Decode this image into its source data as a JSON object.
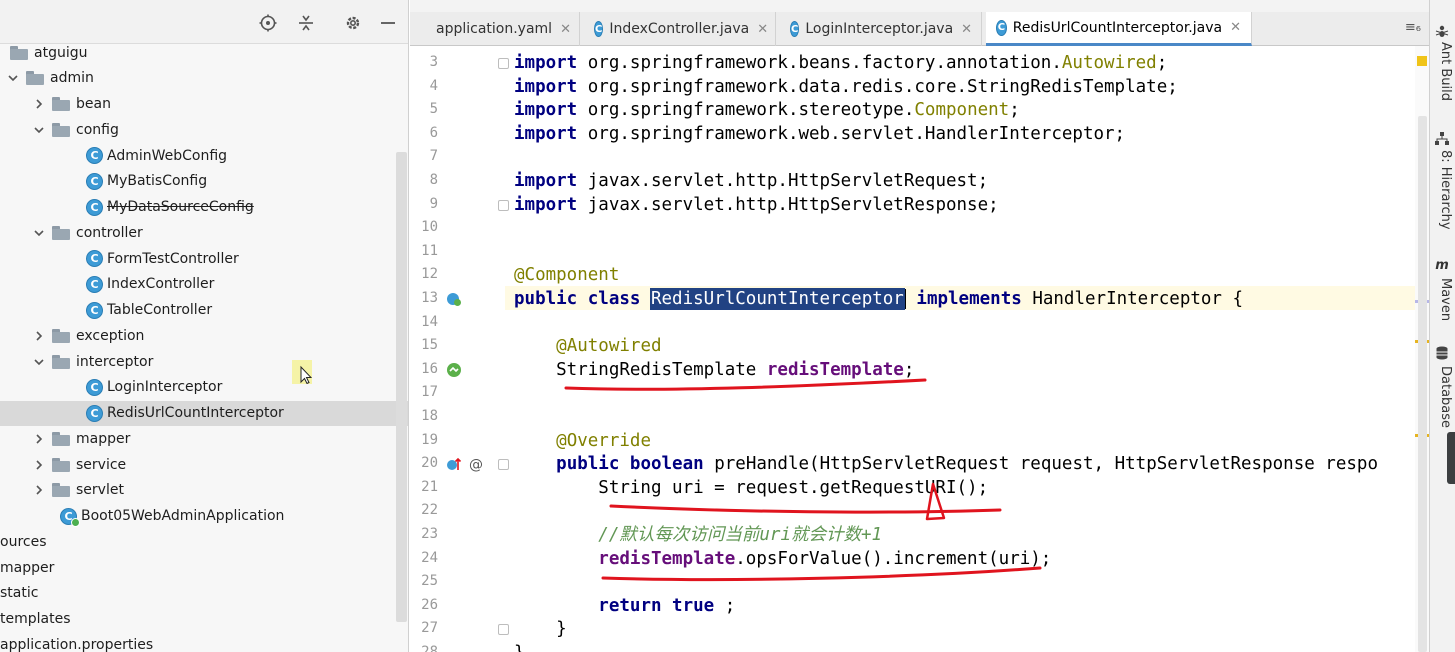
{
  "project": {
    "tools": [
      "locate-icon",
      "collapse-icon",
      "gear-icon",
      "minimize-icon"
    ],
    "tree": [
      {
        "label": "atguigu",
        "level": 0,
        "type": "folder",
        "expanded": null
      },
      {
        "label": "admin",
        "level": 1,
        "type": "folder",
        "expanded": true
      },
      {
        "label": "bean",
        "level": 2,
        "type": "folder",
        "expanded": false
      },
      {
        "label": "config",
        "level": 2,
        "type": "folder",
        "expanded": true
      },
      {
        "label": "AdminWebConfig",
        "level": 3,
        "type": "class"
      },
      {
        "label": "MyBatisConfig",
        "level": 3,
        "type": "class"
      },
      {
        "label": "MyDataSourceConfig",
        "level": 3,
        "type": "class",
        "strike": true
      },
      {
        "label": "controller",
        "level": 2,
        "type": "folder",
        "expanded": true
      },
      {
        "label": "FormTestController",
        "level": 3,
        "type": "class"
      },
      {
        "label": "IndexController",
        "level": 3,
        "type": "class"
      },
      {
        "label": "TableController",
        "level": 3,
        "type": "class"
      },
      {
        "label": "exception",
        "level": 2,
        "type": "folder",
        "expanded": false
      },
      {
        "label": "interceptor",
        "level": 2,
        "type": "folder",
        "expanded": true
      },
      {
        "label": "LoginInterceptor",
        "level": 3,
        "type": "class"
      },
      {
        "label": "RedisUrlCountInterceptor",
        "level": 3,
        "type": "class",
        "selected": true
      },
      {
        "label": "mapper",
        "level": 2,
        "type": "folder",
        "expanded": false
      },
      {
        "label": "service",
        "level": 2,
        "type": "folder",
        "expanded": false
      },
      {
        "label": "servlet",
        "level": 2,
        "type": "folder",
        "expanded": false
      },
      {
        "label": "Boot05WebAdminApplication",
        "level": 2,
        "type": "app"
      },
      {
        "label": "ources",
        "level": -1,
        "type": "text"
      },
      {
        "label": "mapper",
        "level": -1,
        "type": "text"
      },
      {
        "label": "static",
        "level": -1,
        "type": "text"
      },
      {
        "label": "templates",
        "level": -1,
        "type": "text"
      },
      {
        "label": "application.properties",
        "level": -1,
        "type": "text"
      }
    ]
  },
  "tabs": [
    {
      "label": "application.yaml",
      "icon": "yaml-icon",
      "active": false
    },
    {
      "label": "IndexController.java",
      "icon": "class-icon",
      "active": false
    },
    {
      "label": "LoginInterceptor.java",
      "icon": "class-icon",
      "active": false
    },
    {
      "label": "RedisUrlCountInterceptor.java",
      "icon": "class-icon",
      "active": true
    }
  ],
  "tab_menu": "≡₆",
  "code": {
    "lines": [
      {
        "n": "3",
        "parts": [
          [
            "kw",
            "import"
          ],
          [
            "",
            "org.springframework.beans.factory.annotation."
          ],
          [
            "ann",
            "Autowired"
          ],
          [
            "",
            ";"
          ]
        ]
      },
      {
        "n": "4",
        "parts": [
          [
            "kw",
            "import"
          ],
          [
            "",
            "org.springframework.data.redis.core.StringRedisTemplate;"
          ]
        ]
      },
      {
        "n": "5",
        "parts": [
          [
            "kw",
            "import"
          ],
          [
            "",
            "org.springframework.stereotype."
          ],
          [
            "ann",
            "Component"
          ],
          [
            "",
            ";"
          ]
        ]
      },
      {
        "n": "6",
        "parts": [
          [
            "kw",
            "import"
          ],
          [
            "",
            "org.springframework.web.servlet.HandlerInterceptor;"
          ]
        ]
      },
      {
        "n": "7",
        "parts": []
      },
      {
        "n": "8",
        "parts": [
          [
            "kw",
            "import"
          ],
          [
            "",
            "javax.servlet.http.HttpServletRequest;"
          ]
        ]
      },
      {
        "n": "9",
        "parts": [
          [
            "kw",
            "import"
          ],
          [
            "",
            "javax.servlet.http.HttpServletResponse;"
          ]
        ]
      },
      {
        "n": "10",
        "parts": []
      },
      {
        "n": "11",
        "parts": []
      },
      {
        "n": "12",
        "parts": [
          [
            "ann",
            "@Component"
          ]
        ]
      },
      {
        "n": "13",
        "parts": [
          [
            "kw",
            "public class"
          ],
          [
            "",
            ""
          ],
          [
            "sel",
            "RedisUrlCountInterceptor"
          ],
          [
            "",
            ""
          ],
          [
            "kw",
            "implements"
          ],
          [
            "",
            "HandlerInterceptor {"
          ]
        ]
      },
      {
        "n": "14",
        "parts": []
      },
      {
        "n": "15",
        "parts": [
          [
            "",
            "    "
          ],
          [
            "ann",
            "@Autowired"
          ]
        ]
      },
      {
        "n": "16",
        "parts": [
          [
            "",
            "    StringRedisTemplate "
          ],
          [
            "fld",
            "redisTemplate"
          ],
          [
            "",
            ";"
          ]
        ]
      },
      {
        "n": "17",
        "parts": []
      },
      {
        "n": "18",
        "parts": []
      },
      {
        "n": "19",
        "parts": [
          [
            "",
            "    "
          ],
          [
            "ann",
            "@Override"
          ]
        ]
      },
      {
        "n": "20",
        "parts": [
          [
            "",
            "    "
          ],
          [
            "kw",
            "public boolean"
          ],
          [
            "",
            "preHandle(HttpServletRequest request, HttpServletResponse respo"
          ]
        ]
      },
      {
        "n": "21",
        "parts": [
          [
            "",
            "        String uri = request.getRequestURI();"
          ]
        ]
      },
      {
        "n": "22",
        "parts": []
      },
      {
        "n": "23",
        "parts": [
          [
            "",
            "        "
          ],
          [
            "cmt",
            "//默认每次访问当前uri就会计数+1"
          ]
        ]
      },
      {
        "n": "24",
        "parts": [
          [
            "",
            "        "
          ],
          [
            "fld",
            "redisTemplate"
          ],
          [
            "",
            ".opsForValue().increment(uri);"
          ]
        ]
      },
      {
        "n": "25",
        "parts": []
      },
      {
        "n": "26",
        "parts": [
          [
            "",
            "        "
          ],
          [
            "kw",
            "return true"
          ],
          [
            "",
            ";"
          ]
        ]
      },
      {
        "n": "27",
        "parts": [
          [
            "",
            "    }"
          ]
        ]
      },
      {
        "n": "28",
        "parts": [
          [
            "",
            "}"
          ]
        ]
      }
    ]
  },
  "right_tools": [
    "Ant Build",
    "8: Hierarchy",
    "Maven",
    "Database"
  ],
  "colors": {
    "keyword": "#000080",
    "annotation": "#808000",
    "field": "#660e7a",
    "comment": "#629755",
    "selection": "#214283",
    "annotation_stroke": "#e0141e"
  }
}
